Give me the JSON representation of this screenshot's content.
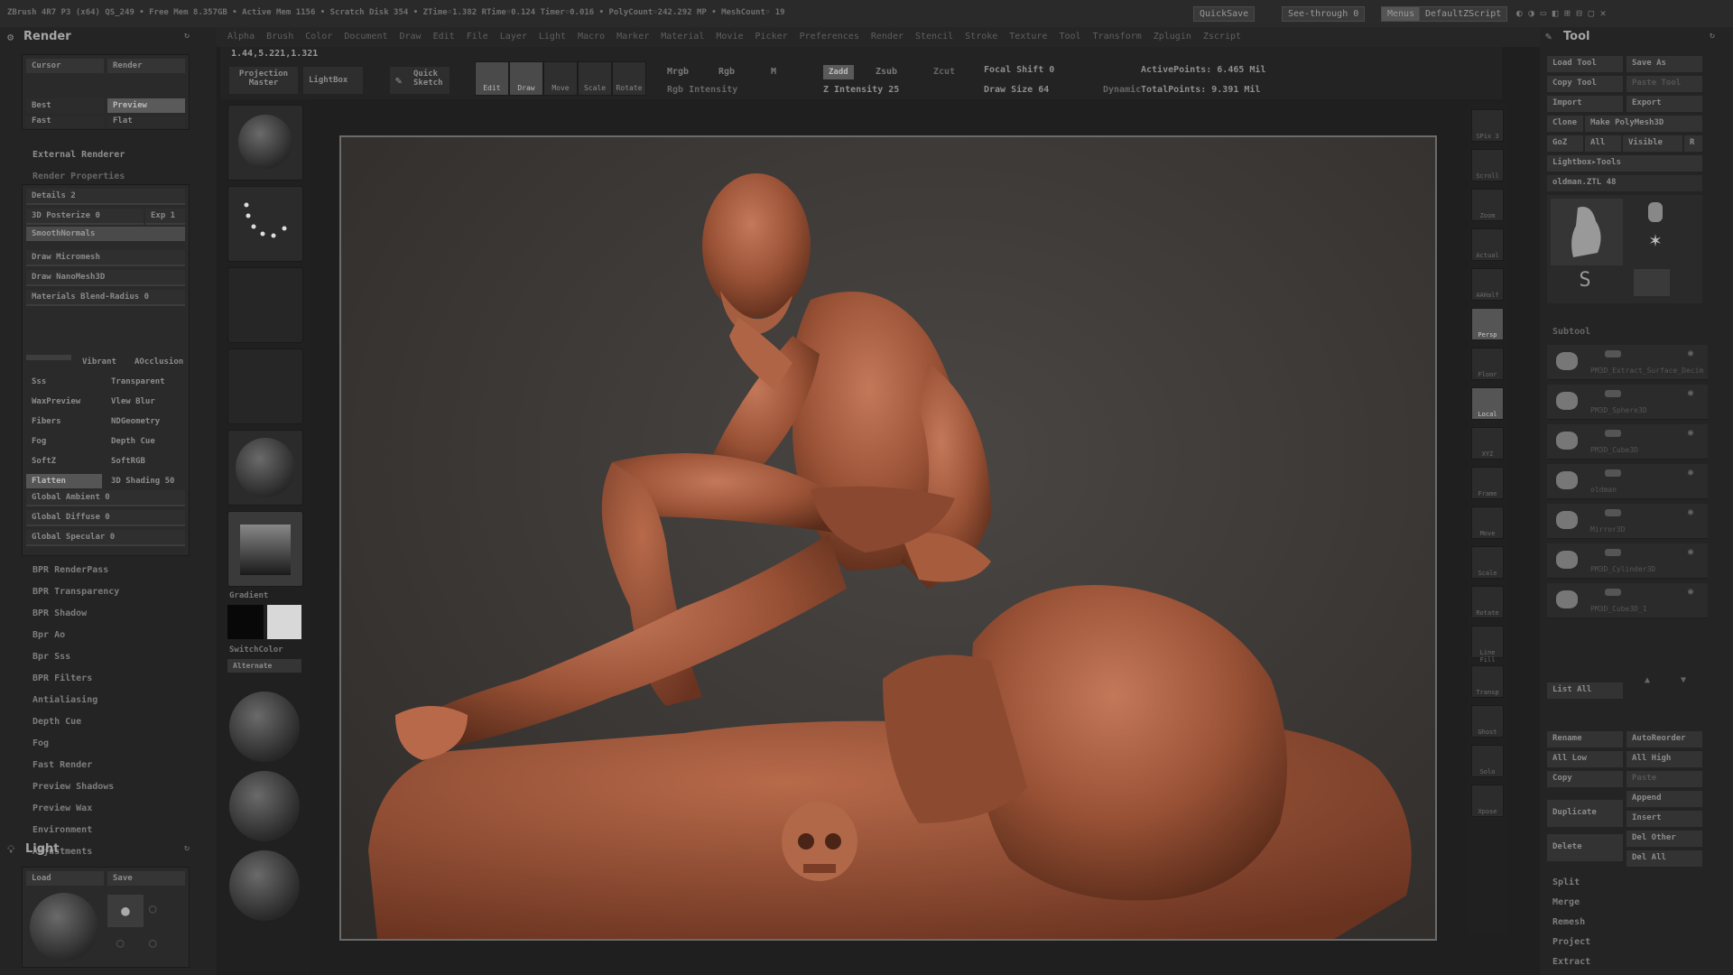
{
  "topbar": {
    "status": "ZBrush 4R7 P3 (x64)   QS_249   • Free Mem 8.357GB • Active Mem 1156 • Scratch Disk 354 • ZTime◦1.382 RTime◦0.124 Timer◦0.016 • PolyCount◦242.292 MP • MeshCount◦ 19",
    "quicksave": "QuickSave",
    "seethrough": "See-through  0",
    "menus": "Menus",
    "script": "DefaultZScript"
  },
  "menubar": [
    "Alpha",
    "Brush",
    "Color",
    "Document",
    "Draw",
    "Edit",
    "File",
    "Layer",
    "Light",
    "Macro",
    "Marker",
    "Material",
    "Movie",
    "Picker",
    "Preferences",
    "Render",
    "Stencil",
    "Stroke",
    "Texture",
    "Tool",
    "Transform",
    "Zplugin",
    "Zscript"
  ],
  "coords": "1.44,5.221,1.321",
  "toolbar": {
    "projection_master": "Projection Master",
    "lightbox": "LightBox",
    "quick_sketch": "Quick Sketch",
    "tools": [
      {
        "label": "Edit",
        "active": true
      },
      {
        "label": "Draw",
        "active": true
      },
      {
        "label": "Move",
        "active": false
      },
      {
        "label": "Scale",
        "active": false
      },
      {
        "label": "Rotate",
        "active": false
      }
    ],
    "mrgb": "Mrgb",
    "rgb": "Rgb",
    "m": "M",
    "rgb_intensity": "Rgb Intensity",
    "zadd": "Zadd",
    "zsub": "Zsub",
    "zcut": "Zcut",
    "z_intensity": "Z Intensity 25",
    "focal_shift": "Focal Shift 0",
    "draw_size": "Draw Size 64",
    "dynamic": "Dynamic",
    "active_points": "ActivePoints: 6.465 Mil",
    "total_points": "TotalPoints: 9.391 Mil"
  },
  "render_panel": {
    "title": "Render",
    "modes": [
      "Cursor",
      "Render",
      "Best",
      "Preview",
      "Fast",
      "Flat"
    ],
    "external_renderer": "External Renderer",
    "render_properties": "Render Properties",
    "details": "Details 2",
    "posterize": "3D Posterize 0",
    "exp": "Exp 1",
    "smooth_normals": "SmoothNormals",
    "draw_micromesh": "Draw Micromesh",
    "draw_nanomesh": "Draw NanoMesh3D",
    "materials_blend": "Materials Blend-Radius 0",
    "grid_left": [
      "Vibrant",
      "Sss",
      "WaxPreview",
      "Fibers",
      "Fog",
      "SoftZ",
      "Flatten"
    ],
    "grid_right": [
      "AOcclusion",
      "Transparent",
      "Vlew Blur",
      "NDGeometry",
      "Depth Cue",
      "SoftRGB",
      "3D Shading 50"
    ],
    "global_ambient": "Global Ambient 0",
    "global_diffuse": "Global Diffuse 0",
    "global_specular": "Global Specular 0",
    "bpr_items": [
      "BPR RenderPass",
      "BPR Transparency",
      "BPR Shadow",
      "Bpr Ao",
      "Bpr Sss",
      "BPR Filters",
      "Antialiasing",
      "Depth Cue",
      "Fog",
      "Fast Render",
      "Preview Shadows",
      "Preview Wax",
      "Environment",
      "Adjustments"
    ]
  },
  "light_panel": {
    "title": "Light",
    "load": "Load",
    "save": "Save"
  },
  "shelf": {
    "gradient": "Gradient",
    "switchcolor": "SwitchColor",
    "alternate": "Alternate"
  },
  "right_shelf": [
    "SPix 3",
    "Scroll",
    "Zoom",
    "Actual",
    "AAHalf",
    "Persp",
    "Floor",
    "Local",
    "XYZ",
    "Frame",
    "Move",
    "Scale",
    "Rotate",
    "Line Fill",
    "Transp",
    "Ghost",
    "Solo",
    "Xpose"
  ],
  "tool_panel": {
    "title": "Tool",
    "load_tool": "Load Tool",
    "save_as": "Save As",
    "copy_tool": "Copy Tool",
    "paste_tool": "Paste Tool",
    "import": "Import",
    "export": "Export",
    "clone": "Clone",
    "make_polymesh": "Make PolyMesh3D",
    "goz": "GoZ",
    "all": "All",
    "visible": "Visible",
    "r": "R",
    "lightbox_tools": "Lightbox▸Tools",
    "current_tool": "oldman.ZTL 48",
    "thumbs": [
      "oldman",
      "Cylinder3D",
      "PolyMesh3D",
      "SimpleBrush",
      "oldman2"
    ],
    "subtool": "Subtool",
    "subtools": [
      "PM3D_Extract_Surface_Decimate",
      "PM3D_Sphere3D",
      "PM3D_Cube3D",
      "oldman",
      "Mirror3D",
      "PM3D_Cylinder3D",
      "PM3D_Cube3D_1"
    ],
    "list_all": "List All",
    "rename": "Rename",
    "autoreorder": "AutoReorder",
    "all_low": "All Low",
    "all_high": "All High",
    "copy": "Copy",
    "paste": "Paste",
    "append": "Append",
    "duplicate": "Duplicate",
    "insert": "Insert",
    "delete": "Delete",
    "del_other": "Del Other",
    "del_all": "Del All",
    "split": "Split",
    "merge": "Merge",
    "remesh": "Remesh",
    "project": "Project",
    "extract": "Extract"
  },
  "colors": {
    "clay": "#a45a3c",
    "bg": "#3a3634",
    "panel": "#242424"
  }
}
